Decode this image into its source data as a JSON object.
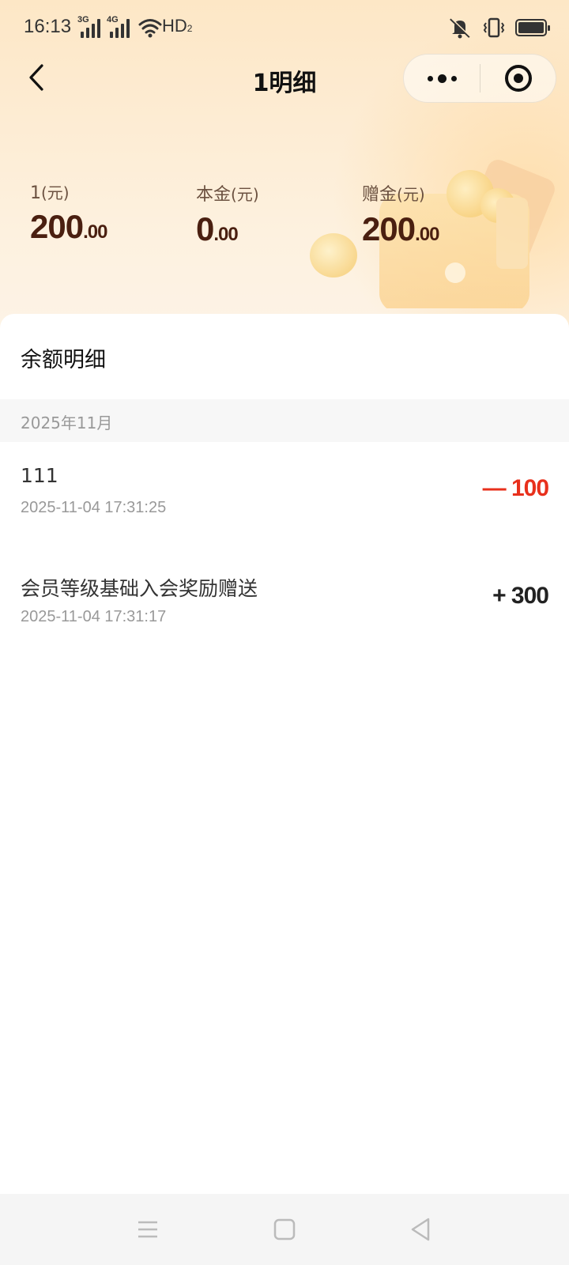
{
  "status_bar": {
    "time": "16:13",
    "network1": "3G",
    "network2": "4G",
    "hd": "HD",
    "hd_sub": "2"
  },
  "nav": {
    "title": "1明细",
    "back_icon": "chevron-left-icon",
    "more_icon": "more-dots-icon",
    "close_icon": "target-icon"
  },
  "summary": [
    {
      "label": "1",
      "unit": "(元)",
      "int": "200",
      "dec": ".00"
    },
    {
      "label": "本金",
      "unit": "(元)",
      "int": "0",
      "dec": ".00"
    },
    {
      "label": "赠金",
      "unit": "(元)",
      "int": "200",
      "dec": ".00"
    }
  ],
  "section_title": "余额明细",
  "month": "2025年11月",
  "transactions": [
    {
      "title": "111",
      "time": "2025-11-04 17:31:25",
      "amount": "— 100",
      "color": "#e8301c"
    },
    {
      "title": "会员等级基础入会奖励赠送",
      "time": "2025-11-04 17:31:17",
      "amount": "+ 300",
      "color": "#222222"
    }
  ],
  "colors": {
    "accent_red": "#e8301c",
    "value_brown": "#4a1f10",
    "header_bg": "#fde7c6"
  }
}
